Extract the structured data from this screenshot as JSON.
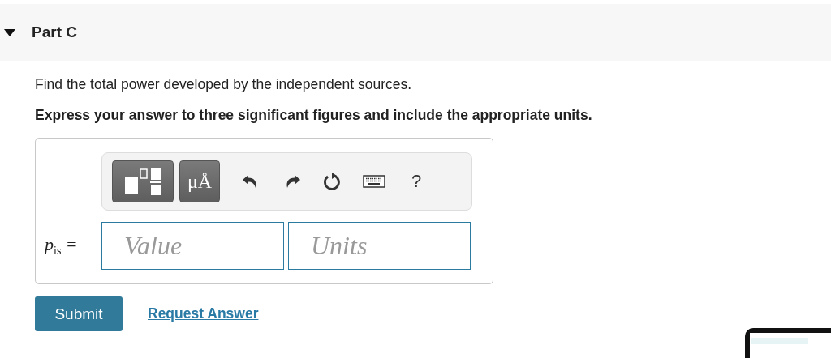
{
  "part": {
    "title": "Part C",
    "expanded": true
  },
  "question": "Find the total power developed by the independent sources.",
  "instruction": "Express your answer to three significant figures and include the appropriate units.",
  "toolbar": {
    "symbol_button": "μÅ",
    "help": "?"
  },
  "answer": {
    "variable": "p$_{is}$",
    "equals": "=",
    "value": {
      "placeholder": "Value"
    },
    "units": {
      "placeholder": "Units"
    }
  },
  "submit": "Submit",
  "request_answer": "Request Answer"
}
